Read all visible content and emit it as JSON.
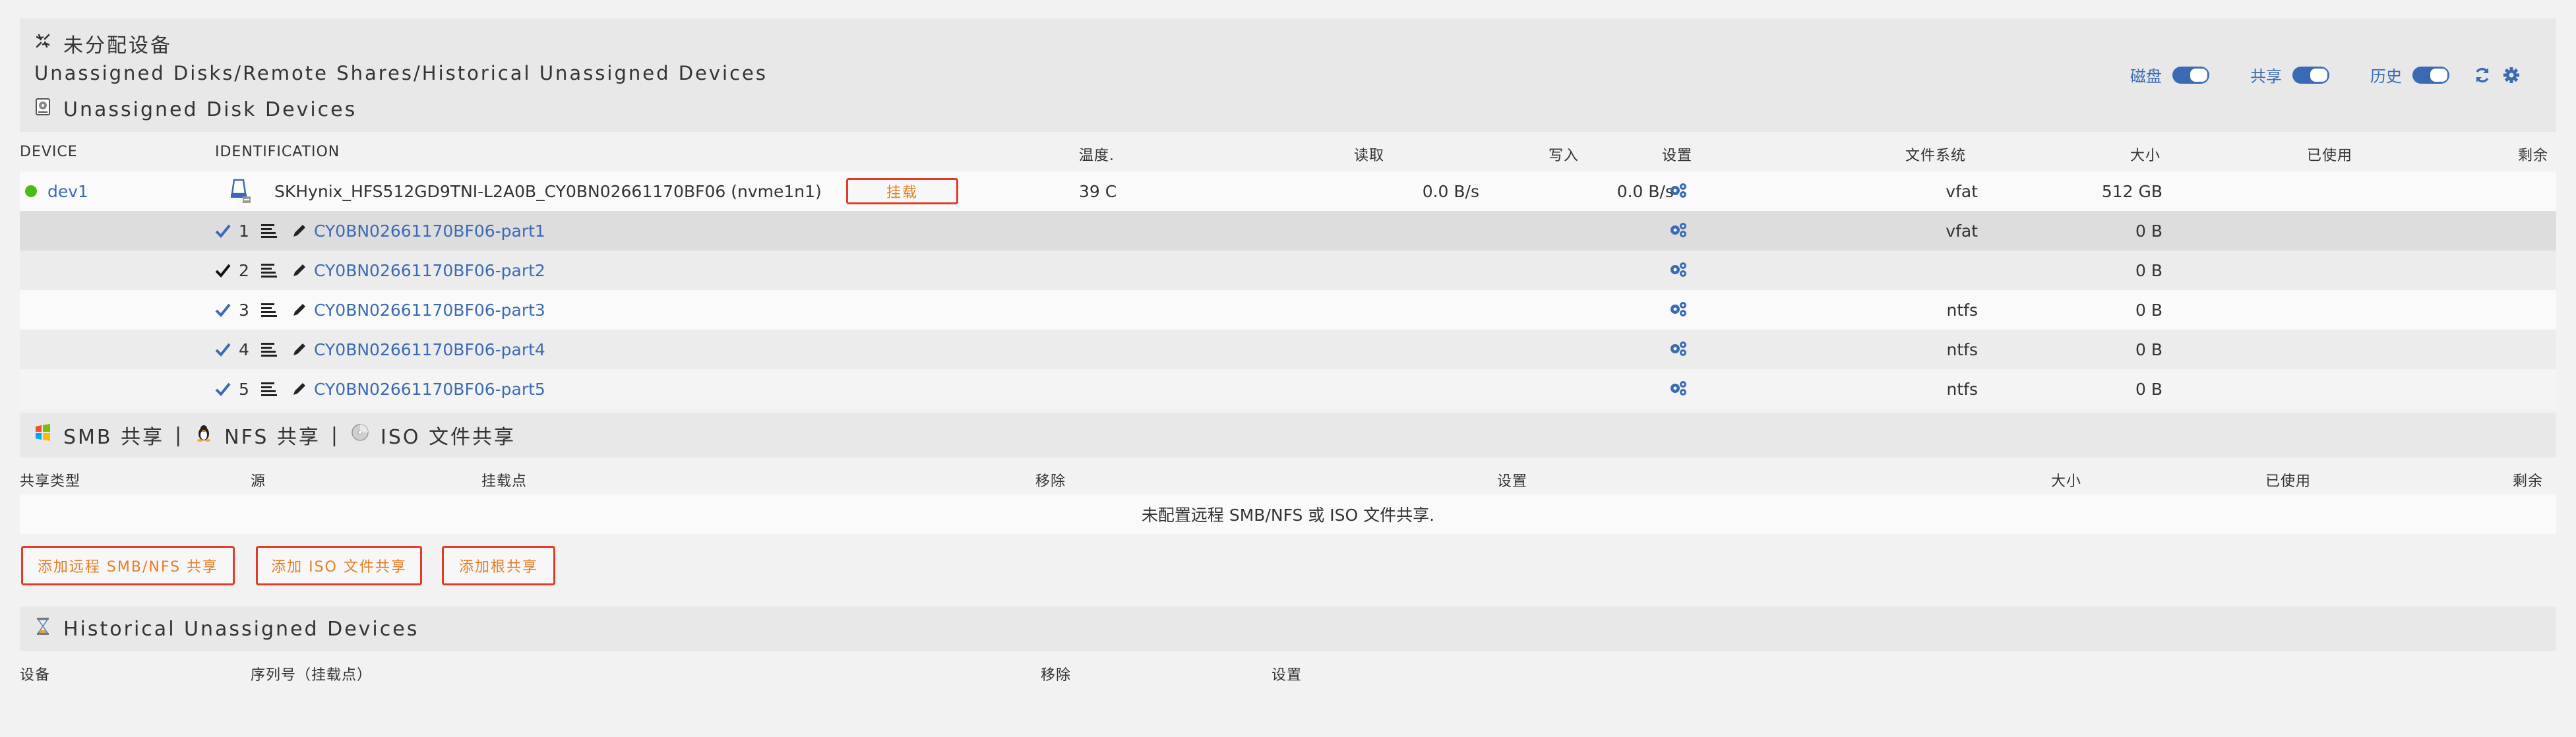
{
  "header": {
    "title": "未分配设备",
    "subtitle": "Unassigned Disks/Remote Shares/Historical Unassigned Devices",
    "toggles": [
      {
        "label": "磁盘",
        "on": true
      },
      {
        "label": "共享",
        "on": true
      },
      {
        "label": "历史",
        "on": true
      }
    ],
    "icons": [
      "refresh-icon",
      "gear-icon"
    ],
    "accent_color": "#3b6ab5"
  },
  "disks": {
    "section_title": "Unassigned Disk Devices",
    "columns": {
      "device": "DEVICE",
      "identification": "IDENTIFICATION",
      "temp": "温度.",
      "read": "读取",
      "write": "写入",
      "settings": "设置",
      "fs": "文件系统",
      "size": "大小",
      "used": "已使用",
      "free": "剩余"
    },
    "device": {
      "name": "dev1",
      "status_color": "#4cbb17",
      "identification": "SKHynix_HFS512GD9TNI-L2A0B_CY0BN02661170BF06 (nvme1n1)",
      "mount_label": "挂载",
      "temp": "39 C",
      "read": "0.0 B/s",
      "write": "0.0 B/s",
      "fs": "vfat",
      "size": "512 GB",
      "used": "",
      "free": ""
    },
    "partitions": [
      {
        "num": "1",
        "name": "CY0BN02661170BF06-part1",
        "fs": "vfat",
        "size": "0 B",
        "check_color": "blue"
      },
      {
        "num": "2",
        "name": "CY0BN02661170BF06-part2",
        "fs": "",
        "size": "0 B",
        "check_color": "black"
      },
      {
        "num": "3",
        "name": "CY0BN02661170BF06-part3",
        "fs": "ntfs",
        "size": "0 B",
        "check_color": "blue"
      },
      {
        "num": "4",
        "name": "CY0BN02661170BF06-part4",
        "fs": "ntfs",
        "size": "0 B",
        "check_color": "blue"
      },
      {
        "num": "5",
        "name": "CY0BN02661170BF06-part5",
        "fs": "ntfs",
        "size": "0 B",
        "check_color": "blue"
      }
    ]
  },
  "shares": {
    "section_smb": "SMB 共享",
    "sep": "|",
    "section_nfs": "NFS 共享",
    "section_iso": "ISO 文件共享",
    "columns": {
      "type": "共享类型",
      "source": "源",
      "mountpoint": "挂载点",
      "remove": "移除",
      "settings": "设置",
      "size": "大小",
      "used": "已使用",
      "free": "剩余"
    },
    "empty_message": "未配置远程 SMB/NFS 或 ISO 文件共享.",
    "buttons": {
      "add_remote": "添加远程 SMB/NFS 共享",
      "add_iso": "添加 ISO 文件共享",
      "add_root": "添加根共享"
    }
  },
  "history": {
    "section_title": "Historical Unassigned Devices",
    "columns": {
      "device": "设备",
      "serial": "序列号（挂载点）",
      "remove": "移除",
      "settings": "设置"
    }
  }
}
